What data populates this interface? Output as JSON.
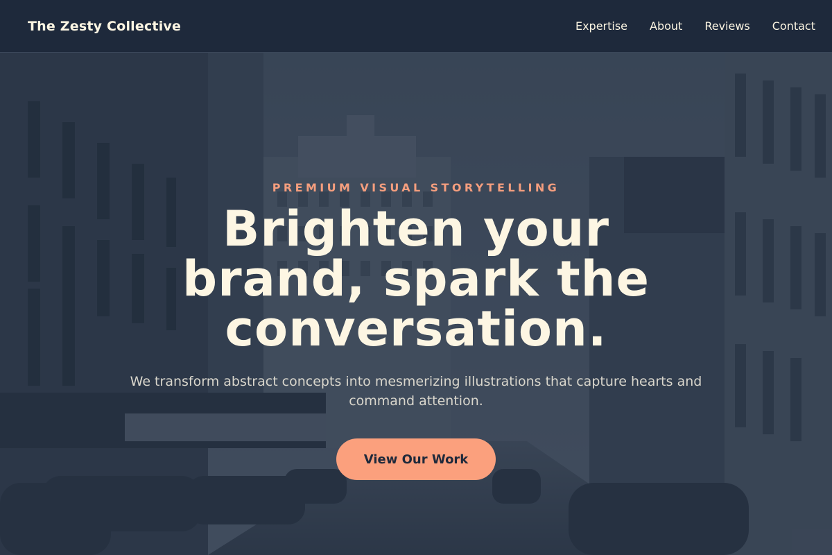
{
  "nav": {
    "brand": "The Zesty Collective",
    "links": [
      "Expertise",
      "About",
      "Reviews",
      "Contact"
    ]
  },
  "hero": {
    "eyebrow": "PREMIUM VISUAL STORYTELLING",
    "headline": "Brighten your brand, spark the conversation.",
    "subtext": "We transform abstract concepts into mesmerizing illustrations that capture hearts and command attention.",
    "cta_label": "View Our Work"
  },
  "colors": {
    "navbar_bg": "#1e293b",
    "accent": "#fba07d",
    "eyebrow": "#f59e7e",
    "headline": "#fdf6e3"
  },
  "background_image": {
    "description": "vintage black-and-white photo of a 1950s downtown street with buildings, signage and parked cars, tinted slate blue"
  }
}
